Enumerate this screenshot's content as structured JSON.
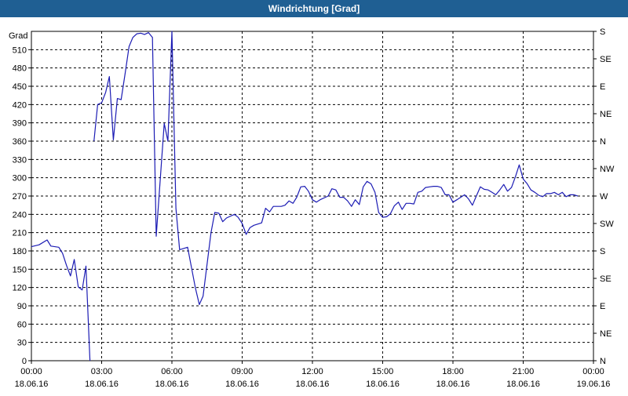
{
  "window": {
    "title": "Windrichtung [Grad]"
  },
  "chart_data": {
    "type": "line",
    "title": "Windrichtung [Grad]",
    "ylabel": "Grad",
    "xlabel": "",
    "ylim": [
      0,
      540
    ],
    "xlim_hours": [
      0,
      24
    ],
    "yticks": [
      0,
      30,
      60,
      90,
      120,
      150,
      180,
      210,
      240,
      270,
      300,
      330,
      360,
      390,
      420,
      450,
      480,
      510
    ],
    "right_ticks": [
      {
        "value": 0,
        "label": "N"
      },
      {
        "value": 45,
        "label": "NE"
      },
      {
        "value": 90,
        "label": "E"
      },
      {
        "value": 135,
        "label": "SE"
      },
      {
        "value": 180,
        "label": "S"
      },
      {
        "value": 225,
        "label": "SW"
      },
      {
        "value": 270,
        "label": "W"
      },
      {
        "value": 315,
        "label": "NW"
      },
      {
        "value": 360,
        "label": "N"
      },
      {
        "value": 405,
        "label": "NE"
      },
      {
        "value": 450,
        "label": "E"
      },
      {
        "value": 495,
        "label": "SE"
      },
      {
        "value": 540,
        "label": "S"
      }
    ],
    "xticks": [
      {
        "time": "00:00",
        "date": "18.06.16"
      },
      {
        "time": "03:00",
        "date": "18.06.16"
      },
      {
        "time": "06:00",
        "date": "18.06.16"
      },
      {
        "time": "09:00",
        "date": "18.06.16"
      },
      {
        "time": "12:00",
        "date": "18.06.16"
      },
      {
        "time": "15:00",
        "date": "18.06.16"
      },
      {
        "time": "18:00",
        "date": "18.06.16"
      },
      {
        "time": "21:00",
        "date": "18.06.16"
      },
      {
        "time": "00:00",
        "date": "19.06.16"
      }
    ],
    "grid": true,
    "series": [
      {
        "color": "#1c1cb4",
        "segments": [
          [
            [
              0.0,
              187
            ],
            [
              0.33,
              190
            ],
            [
              0.67,
              198
            ],
            [
              0.83,
              188
            ],
            [
              1.17,
              186
            ],
            [
              1.33,
              176
            ],
            [
              1.5,
              156
            ],
            [
              1.67,
              139
            ],
            [
              1.83,
              166
            ],
            [
              2.0,
              121
            ],
            [
              2.17,
              116
            ],
            [
              2.33,
              155
            ],
            [
              2.5,
              0
            ]
          ],
          [
            [
              2.67,
              360
            ],
            [
              2.83,
              420
            ],
            [
              3.0,
              423
            ],
            [
              3.17,
              440
            ],
            [
              3.33,
              466
            ],
            [
              3.5,
              362
            ],
            [
              3.67,
              430
            ],
            [
              3.83,
              428
            ],
            [
              4.0,
              470
            ],
            [
              4.17,
              515
            ],
            [
              4.33,
              530
            ],
            [
              4.5,
              536
            ],
            [
              4.67,
              537
            ],
            [
              4.83,
              535
            ],
            [
              5.0,
              538
            ],
            [
              5.17,
              530
            ],
            [
              5.33,
              204
            ],
            [
              5.67,
              389
            ],
            [
              5.83,
              360
            ],
            [
              6.0,
              543
            ],
            [
              6.17,
              250
            ],
            [
              6.33,
              182
            ],
            [
              6.67,
              186
            ],
            [
              7.0,
              120
            ],
            [
              7.17,
              92
            ],
            [
              7.33,
              106
            ],
            [
              7.67,
              210
            ],
            [
              7.83,
              243
            ],
            [
              8.0,
              242
            ],
            [
              8.17,
              228
            ],
            [
              8.33,
              234
            ],
            [
              8.67,
              240
            ],
            [
              8.83,
              235
            ],
            [
              9.0,
              225
            ],
            [
              9.17,
              207
            ],
            [
              9.33,
              218
            ],
            [
              9.5,
              222
            ],
            [
              9.83,
              226
            ],
            [
              10.0,
              250
            ],
            [
              10.17,
              244
            ],
            [
              10.33,
              253
            ],
            [
              10.67,
              253
            ],
            [
              10.83,
              255
            ],
            [
              11.0,
              262
            ],
            [
              11.17,
              258
            ],
            [
              11.33,
              268
            ],
            [
              11.5,
              285
            ],
            [
              11.67,
              286
            ],
            [
              11.83,
              278
            ],
            [
              12.0,
              264
            ],
            [
              12.17,
              260
            ],
            [
              12.33,
              264
            ],
            [
              12.67,
              270
            ],
            [
              12.83,
              282
            ],
            [
              13.0,
              280
            ],
            [
              13.17,
              268
            ],
            [
              13.33,
              268
            ],
            [
              13.5,
              262
            ],
            [
              13.67,
              253
            ],
            [
              13.83,
              264
            ],
            [
              14.0,
              256
            ],
            [
              14.17,
              285
            ],
            [
              14.33,
              294
            ],
            [
              14.5,
              290
            ],
            [
              14.67,
              276
            ],
            [
              14.83,
              243
            ],
            [
              15.0,
              235
            ],
            [
              15.17,
              236
            ],
            [
              15.33,
              241
            ],
            [
              15.5,
              254
            ],
            [
              15.67,
              260
            ],
            [
              15.83,
              248
            ],
            [
              16.0,
              258
            ],
            [
              16.17,
              258
            ],
            [
              16.33,
              257
            ],
            [
              16.5,
              276
            ],
            [
              16.67,
              278
            ],
            [
              16.83,
              284
            ],
            [
              17.0,
              285
            ],
            [
              17.17,
              286
            ],
            [
              17.33,
              286
            ],
            [
              17.5,
              284
            ],
            [
              17.67,
              272
            ],
            [
              17.83,
              272
            ],
            [
              18.0,
              260
            ],
            [
              18.17,
              264
            ],
            [
              18.33,
              268
            ],
            [
              18.5,
              272
            ],
            [
              18.67,
              265
            ],
            [
              18.83,
              255
            ],
            [
              19.0,
              270
            ],
            [
              19.17,
              285
            ],
            [
              19.33,
              281
            ],
            [
              19.5,
              280
            ],
            [
              19.67,
              276
            ],
            [
              19.83,
              272
            ],
            [
              20.0,
              280
            ],
            [
              20.17,
              289
            ],
            [
              20.33,
              278
            ],
            [
              20.5,
              284
            ],
            [
              20.67,
              302
            ],
            [
              20.83,
              321
            ],
            [
              21.0,
              298
            ],
            [
              21.17,
              290
            ],
            [
              21.33,
              280
            ],
            [
              21.5,
              276
            ],
            [
              21.67,
              271
            ],
            [
              21.83,
              269
            ],
            [
              22.0,
              274
            ],
            [
              22.17,
              274
            ],
            [
              22.33,
              276
            ],
            [
              22.5,
              272
            ],
            [
              22.67,
              276
            ],
            [
              22.83,
              269
            ],
            [
              23.0,
              272
            ],
            [
              23.17,
              272
            ],
            [
              23.33,
              270
            ]
          ]
        ]
      }
    ]
  }
}
